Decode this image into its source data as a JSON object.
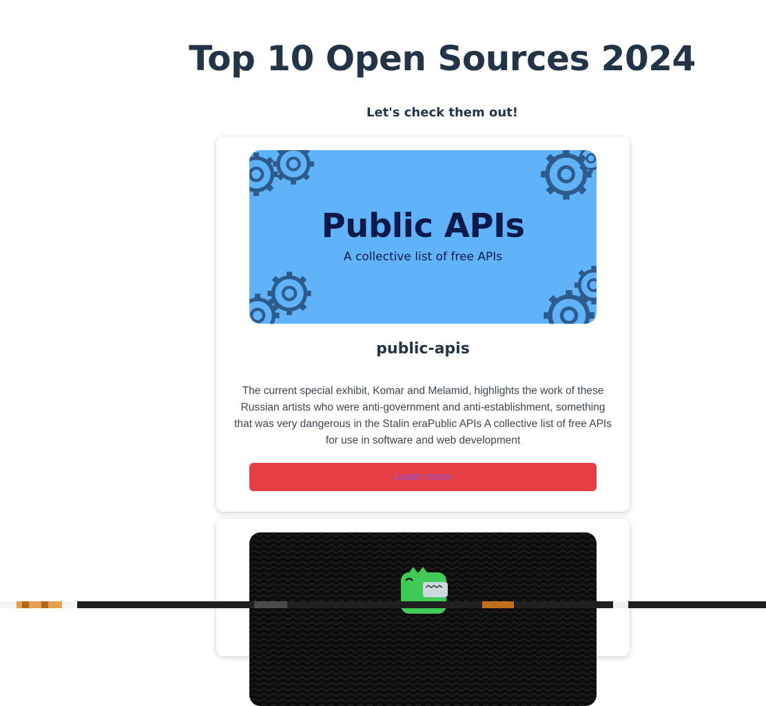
{
  "page": {
    "title": "Top 10 Open Sources 2024",
    "subtitle": "Let's check them out!"
  },
  "cards": [
    {
      "banner": {
        "heading": "Public APIs",
        "subheading": "A collective list of free APIs",
        "background": "#60b2f9"
      },
      "title": "public-apis",
      "description": "The current special exhibit, Komar and Melamid, highlights the work of these Russian artists who were anti-government and anti-establishment, something that was very dangerous in the Stalin eraPublic APIs A collective list of free APIs for use in software and web development",
      "button_label": "Learn more",
      "button_color": "#e63f43",
      "button_text_color": "#8a56e8"
    },
    {
      "banner": {
        "background": "#0d0d0d",
        "icon": "green-dinosaur-mascot-icon"
      }
    }
  ],
  "icons": [
    "gear-icon",
    "green-dinosaur-mascot-icon"
  ],
  "colors": {
    "title": "#243447",
    "banner_gear": "#2d5c8c"
  }
}
